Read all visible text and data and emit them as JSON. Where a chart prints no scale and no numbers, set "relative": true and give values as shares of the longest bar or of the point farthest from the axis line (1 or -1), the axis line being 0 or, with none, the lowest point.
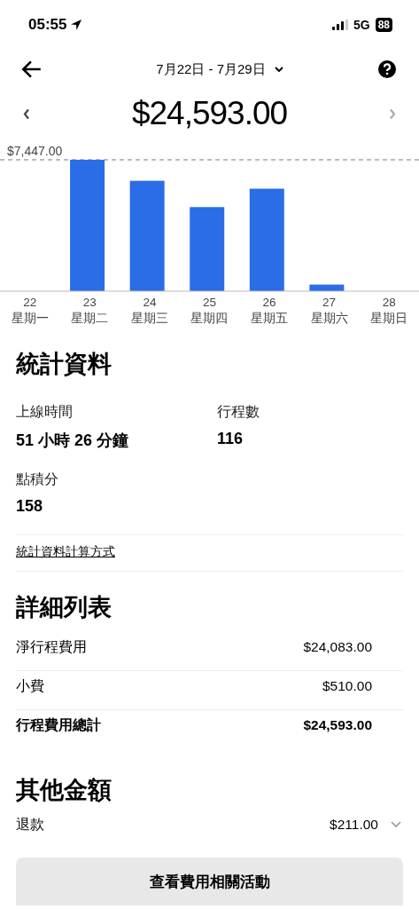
{
  "status_bar": {
    "time": "05:55",
    "network": "5G",
    "battery": "88"
  },
  "header": {
    "date_range": "7月22日 - 7月29日"
  },
  "total": {
    "amount": "$24,593.00"
  },
  "chart": {
    "chart_data": {
      "type": "bar",
      "categories": [
        "22\n星期一",
        "23\n星期二",
        "24\n星期三",
        "25\n星期四",
        "26\n星期五",
        "27\n星期六",
        "28\n星期日"
      ],
      "series": [
        {
          "color": "#2a6de6",
          "values": [
            0,
            1,
            0.84,
            0.64,
            0.78,
            0.05,
            0
          ]
        }
      ],
      "relative": true,
      "annotations": [
        {
          "text": "$7,447.00"
        }
      ]
    }
  },
  "stats": {
    "title": "統計資料",
    "items": [
      {
        "label": "上線時間",
        "value": "51 小時 26 分鐘"
      },
      {
        "label": "行程數",
        "value": "116"
      },
      {
        "label": "點積分",
        "value": "158"
      }
    ],
    "link": "統計資料計算方式"
  },
  "breakdown": {
    "title": "詳細列表",
    "rows": [
      {
        "label": "淨行程費用",
        "value": "$24,083.00",
        "bold": false
      },
      {
        "label": "小費",
        "value": "$510.00",
        "bold": false
      },
      {
        "label": "行程費用總計",
        "value": "$24,593.00",
        "bold": true
      }
    ]
  },
  "other": {
    "title": "其他金額",
    "rows": [
      {
        "label": "退款",
        "value": "$211.00",
        "expanded": false
      }
    ]
  },
  "button": {
    "label": "查看費用相關活動"
  }
}
